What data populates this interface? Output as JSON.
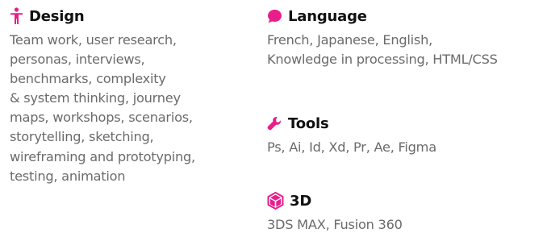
{
  "accent_color": "#e91e8c",
  "sections": {
    "design": {
      "icon": "person-accessibility-icon",
      "title": "Design",
      "lines": [
        "Team work, user research,",
        "personas, interviews,",
        "benchmarks, complexity",
        "& system thinking, journey",
        "maps, workshops, scenarios,",
        "storytelling, sketching,",
        "wireframing and prototyping,",
        "testing, animation"
      ]
    },
    "language": {
      "icon": "speech-bubble-icon",
      "title": "Language",
      "lines": [
        "French, Japanese, English,",
        "Knowledge in processing, HTML/CSS"
      ]
    },
    "tools": {
      "icon": "wrench-icon",
      "title": "Tools",
      "lines": [
        "Ps, Ai, Id, Xd, Pr, Ae, Figma"
      ]
    },
    "three_d": {
      "icon": "cube-icon",
      "title": "3D",
      "lines": [
        "3DS MAX, Fusion 360"
      ]
    }
  }
}
